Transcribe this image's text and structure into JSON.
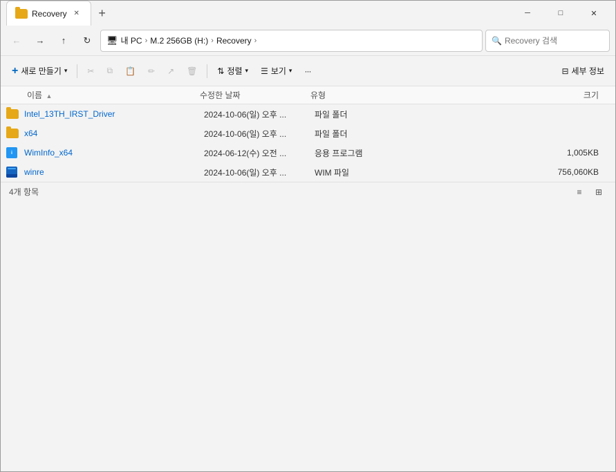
{
  "titleBar": {
    "tab": {
      "label": "Recovery",
      "closeLabel": "✕"
    },
    "newTabLabel": "+",
    "controls": {
      "minimize": "─",
      "maximize": "□",
      "close": "✕"
    }
  },
  "addressBar": {
    "nav": {
      "back": "←",
      "forward": "→",
      "up": "↑",
      "refresh": "↻"
    },
    "breadcrumbs": [
      {
        "label": "내 PC",
        "sep": "›"
      },
      {
        "label": "M.2 256GB (H:)",
        "sep": "›"
      },
      {
        "label": "Recovery",
        "sep": "›"
      }
    ],
    "search": {
      "placeholder": "Recovery 검색"
    }
  },
  "toolbar": {
    "newButton": "새로 만들기",
    "cut": "✂",
    "copy": "⧉",
    "paste": "📋",
    "rename": "✏",
    "share": "↗",
    "delete": "🗑",
    "sort": "정렬",
    "view": "보기",
    "more": "···",
    "detail": "세부 정보"
  },
  "fileList": {
    "headers": {
      "name": "이름",
      "date": "수정한 날짜",
      "type": "유형",
      "size": "크기"
    },
    "items": [
      {
        "name": "Intel_13TH_IRST_Driver",
        "date": "2024-10-06(일) 오후 ...",
        "type": "파일 폴더",
        "size": "",
        "iconType": "folder"
      },
      {
        "name": "x64",
        "date": "2024-10-06(일) 오후 ...",
        "type": "파일 폴더",
        "size": "",
        "iconType": "folder"
      },
      {
        "name": "WimInfo_x64",
        "date": "2024-06-12(수) 오전 ...",
        "type": "응용 프로그램",
        "size": "1,005KB",
        "iconType": "app"
      },
      {
        "name": "winre",
        "date": "2024-10-06(일) 오후 ...",
        "type": "WIM 파일",
        "size": "756,060KB",
        "iconType": "wim"
      }
    ]
  },
  "statusBar": {
    "itemCount": "4개 항목"
  }
}
